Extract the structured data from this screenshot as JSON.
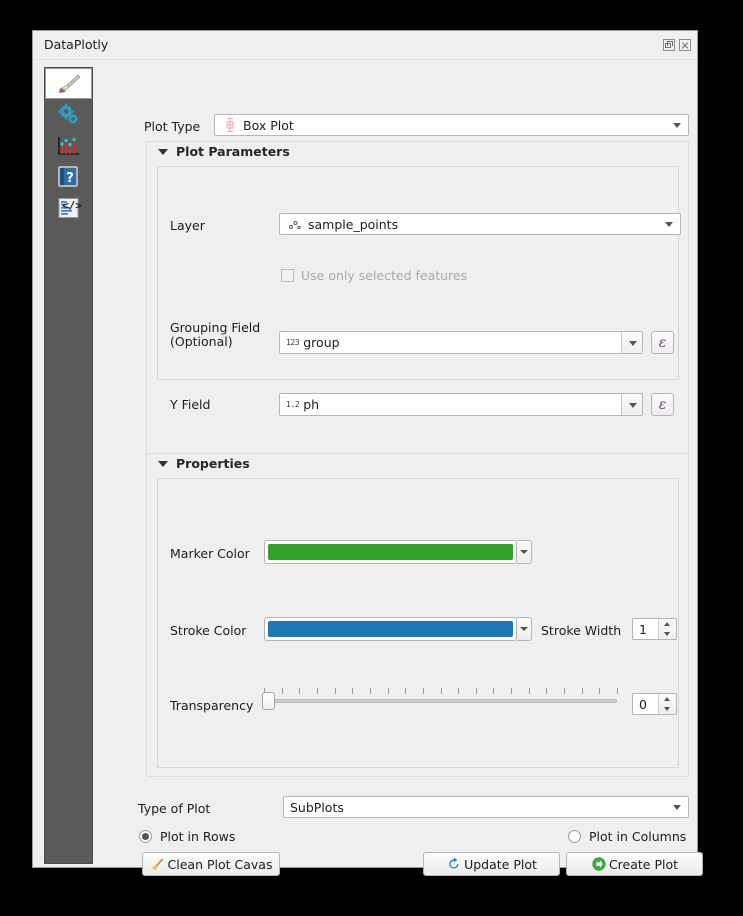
{
  "window": {
    "title": "DataPlotly",
    "titlebar_buttons": [
      {
        "name": "restore-button",
        "label": "Restore"
      },
      {
        "name": "close-button",
        "label": "Close"
      }
    ]
  },
  "sidebar": {
    "items": [
      {
        "icon": "paintbrush-icon",
        "label": "Plot Settings",
        "selected": true
      },
      {
        "icon": "gears-icon",
        "label": "Plot Configuration",
        "selected": false
      },
      {
        "icon": "bar-chart-icon",
        "label": "Plot View",
        "selected": false
      },
      {
        "icon": "help-book-icon",
        "label": "Help",
        "selected": false
      },
      {
        "icon": "code-document-icon",
        "label": "Code",
        "selected": false
      }
    ]
  },
  "plot_type": {
    "label": "Plot Type",
    "value": "Box Plot",
    "icon": "box-plot-icon"
  },
  "plot_parameters": {
    "title": "Plot Parameters",
    "expanded": true,
    "layer": {
      "label": "Layer",
      "value": "sample_points",
      "icon": "point-layer-icon"
    },
    "use_selected": {
      "label": "Use only selected features",
      "checked": false,
      "enabled": false
    },
    "grouping_field": {
      "label": "Grouping Field\n(Optional)",
      "label_line1": "Grouping Field",
      "label_line2": "(Optional)",
      "value": "group",
      "field_type_icon": "123",
      "expression_button": "ε"
    },
    "y_field": {
      "label": "Y Field",
      "value": "ph",
      "field_type_icon": "1.2",
      "expression_button": "ε"
    }
  },
  "properties": {
    "title": "Properties",
    "expanded": true,
    "marker_color": {
      "label": "Marker Color",
      "value": "#33a02c"
    },
    "stroke_color": {
      "label": "Stroke Color",
      "value": "#1f78b4"
    },
    "stroke_width": {
      "label": "Stroke Width",
      "value": "1"
    },
    "transparency": {
      "label": "Transparency",
      "value": "0",
      "min": 0,
      "max": 100,
      "percent": 0
    }
  },
  "footer": {
    "type_of_plot": {
      "label": "Type of Plot",
      "value": "SubPlots"
    },
    "plot_in_rows": {
      "label": "Plot in Rows",
      "checked": true
    },
    "plot_in_columns": {
      "label": "Plot in Columns",
      "checked": false
    },
    "clean_button": {
      "label": "Clean Plot Cavas",
      "icon": "broom-icon"
    },
    "update_button": {
      "label": "Update Plot",
      "icon": "refresh-icon"
    },
    "create_button": {
      "label": "Create Plot",
      "icon": "green-arrow-icon"
    }
  }
}
